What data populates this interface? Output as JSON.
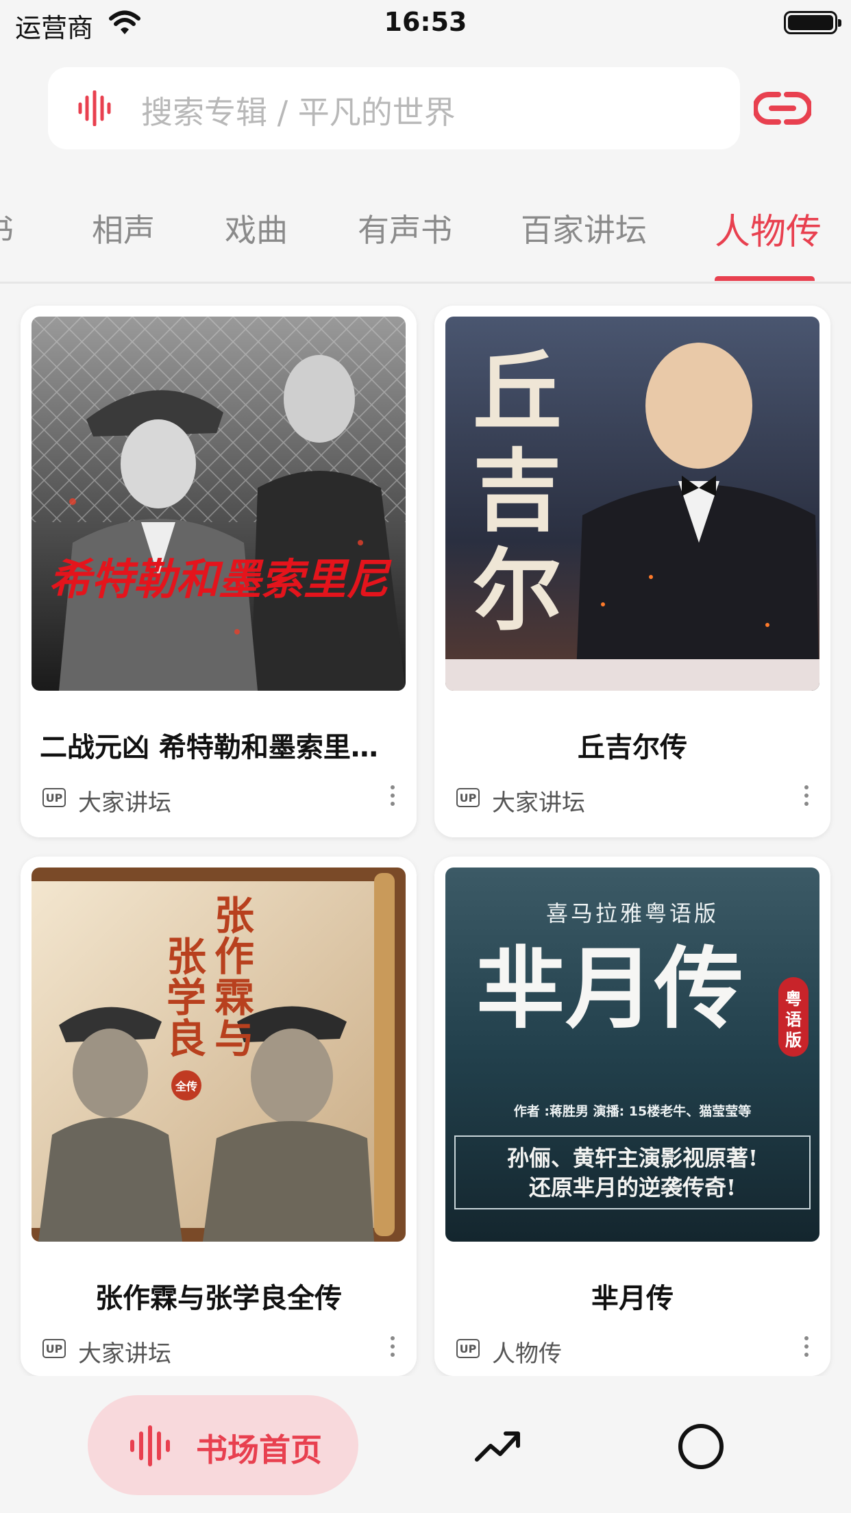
{
  "status_bar": {
    "carrier": "运营商",
    "time": "16:53"
  },
  "search": {
    "placeholder": "搜索专辑 / 平凡的世界"
  },
  "tabs": [
    {
      "label": "书",
      "active": false
    },
    {
      "label": "相声",
      "active": false
    },
    {
      "label": "戏曲",
      "active": false
    },
    {
      "label": "有声书",
      "active": false
    },
    {
      "label": "百家讲坛",
      "active": false
    },
    {
      "label": "人物传",
      "active": true
    }
  ],
  "cards": [
    {
      "title": "二战元凶 希特勒和墨索里…",
      "source": "大家讲坛",
      "badge": "UP",
      "cover_text": "希特勒和墨索里尼"
    },
    {
      "title": "丘吉尔传",
      "source": "大家讲坛",
      "badge": "UP",
      "cover_text": [
        "丘",
        "吉",
        "尔"
      ]
    },
    {
      "title": "张作霖与张学良全传",
      "source": "大家讲坛",
      "badge": "UP",
      "cover_text": [
        "张",
        "作",
        "霖",
        "与",
        "张",
        "学",
        "良",
        "全传"
      ]
    },
    {
      "title": "芈月传",
      "source": "人物传",
      "badge": "UP",
      "cover_text": {
        "banner": "喜马拉雅粤语版",
        "title": "芈月传",
        "stamp": "粤语版",
        "credits": "作者 :蒋胜男    演播: 15楼老牛、猫莹莹等",
        "line1": "孙俪、黄轩主演影视原著!",
        "line2": "还原芈月的逆袭传奇!"
      }
    }
  ],
  "bottom_nav": {
    "home_label": "书场首页"
  },
  "colors": {
    "accent": "#e8404f",
    "accent_light": "#f8d9dc",
    "background": "#f5f5f5"
  }
}
